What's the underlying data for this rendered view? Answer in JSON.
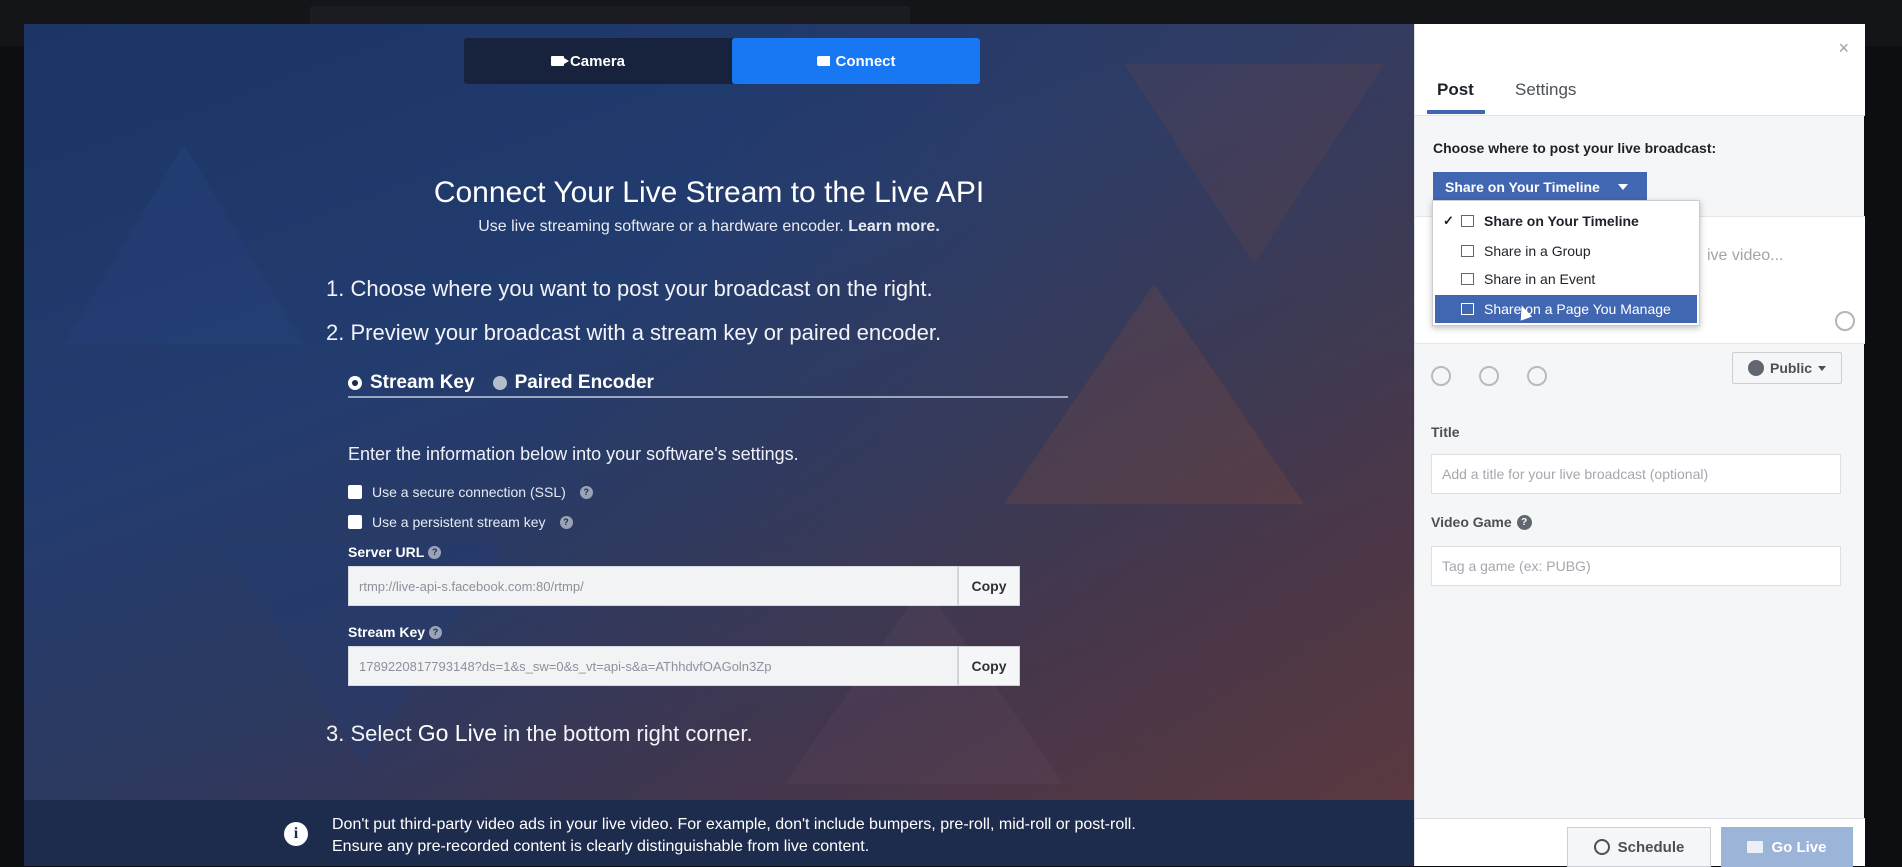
{
  "mode_tabs": {
    "camera": "Camera",
    "connect": "Connect"
  },
  "main": {
    "heading": "Connect Your Live Stream to the Live API",
    "subhead": "Use live streaming software or a hardware encoder.",
    "learn_more": "Learn more.",
    "step1": "1. Choose where you want to post your broadcast on the right.",
    "step2": "2. Preview your broadcast with a stream key or paired encoder.",
    "radio_stream_key": "Stream Key",
    "radio_paired_encoder": "Paired Encoder",
    "info_line": "Enter the information below into your software's settings.",
    "chk_ssl": "Use a secure connection (SSL)",
    "chk_persistent": "Use a persistent stream key",
    "server_url_label": "Server URL",
    "server_url_value": "rtmp://live-api-s.facebook.com:80/rtmp/",
    "stream_key_label": "Stream Key",
    "stream_key_value": "1789220817793148?ds=1&s_sw=0&s_vt=api-s&a=AThhdvfOAGoln3Zp",
    "copy": "Copy",
    "step3_prefix": "3. Select",
    "step3_bold": "Go Live",
    "step3_suffix": "in the bottom right corner.",
    "notice": "Don't put third-party video ads in your live video. For example, don't include bumpers, pre-roll, mid-roll or post-roll. Ensure any pre-recorded content is clearly distinguishable from live content."
  },
  "panel": {
    "close": "×",
    "tab_post": "Post",
    "tab_settings": "Settings",
    "choose": "Choose where to post your live broadcast:",
    "share_button": "Share on Your Timeline",
    "composer_placeholder": "ive video...",
    "public": "Public",
    "title_label": "Title",
    "title_placeholder": "Add a title for your live broadcast (optional)",
    "game_label": "Video Game",
    "game_placeholder": "Tag a game (ex: PUBG)",
    "schedule": "Schedule",
    "go_live": "Go Live"
  },
  "dropdown": {
    "items": [
      {
        "label": "Share on Your Timeline",
        "checked": true
      },
      {
        "label": "Share in a Group"
      },
      {
        "label": "Share in an Event"
      },
      {
        "label": "Share on a Page You Manage",
        "highlighted": true
      }
    ]
  },
  "colors": {
    "accent": "#1877f2",
    "fb_blue": "#4267b2",
    "stage_bg": "#233c6f"
  }
}
